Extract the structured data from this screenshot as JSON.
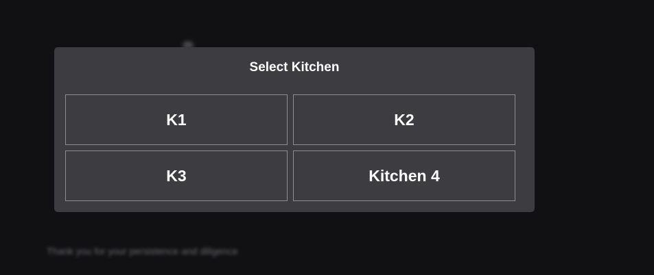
{
  "modal": {
    "title": "Select Kitchen",
    "options": [
      {
        "label": "K1"
      },
      {
        "label": "K2"
      },
      {
        "label": "K3"
      },
      {
        "label": "Kitchen 4"
      }
    ]
  },
  "background": {
    "footer_text": "Thank you for your persistence and diligence"
  },
  "colors": {
    "page_background": "#111113",
    "modal_background": "#3c3c41",
    "button_border": "#8e8e93",
    "text": "#ffffff"
  }
}
